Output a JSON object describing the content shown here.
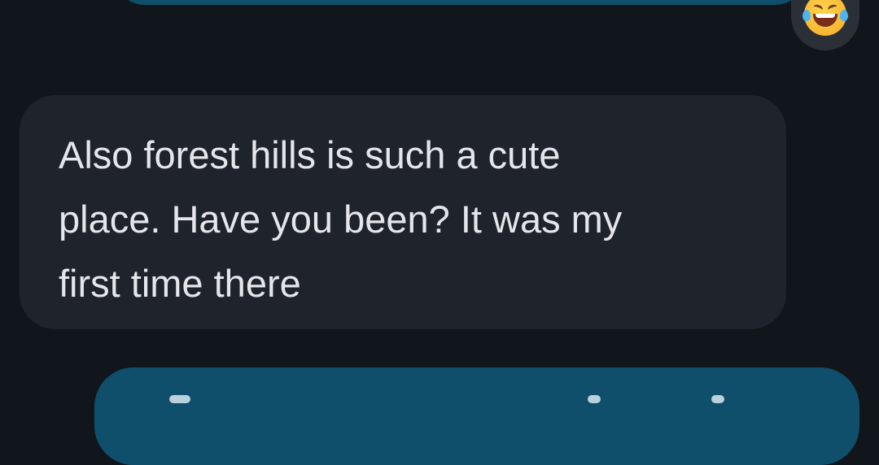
{
  "conversation": {
    "outgoing_top": {
      "reaction": {
        "icon": "face-with-tears-of-joy-icon"
      }
    },
    "incoming": {
      "text": "Also forest hills is such a cute\nplace. Have you been? It was my\nfirst time there"
    },
    "outgoing_bottom": {}
  },
  "colors": {
    "background": "#11151c",
    "outgoing_bubble": "#0f4f6b",
    "incoming_bubble": "#1f232b",
    "incoming_text": "#e4e6eb",
    "reaction_chip": "#2b2f36"
  }
}
